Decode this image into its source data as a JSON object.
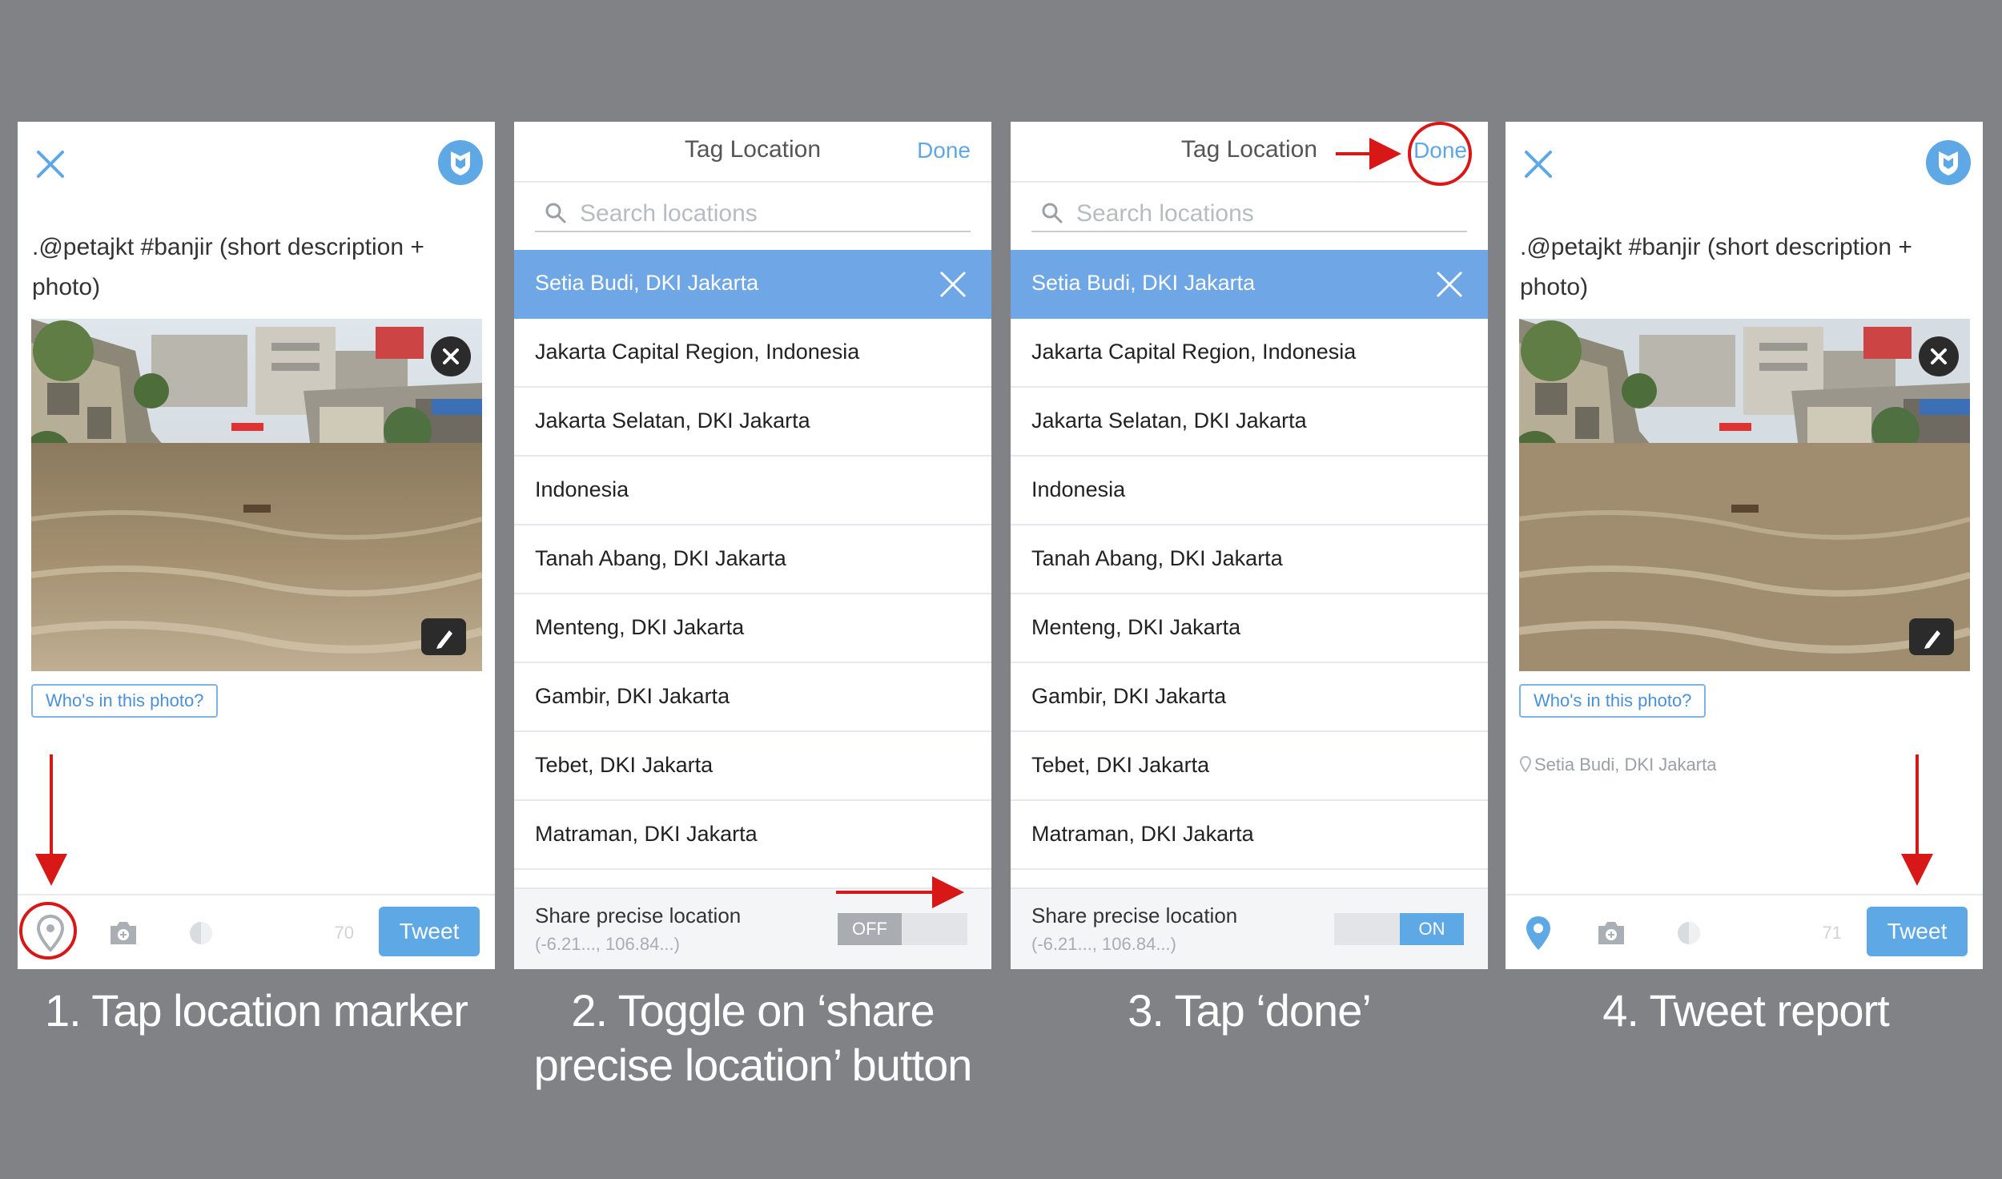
{
  "colors": {
    "background": "#808286",
    "accent": "#5ea8e6",
    "annotation": "#d81717"
  },
  "compose": {
    "tweet_text": ".@petajkt #banjir (short description + photo)",
    "who_in_photo": "Who's in this photo?",
    "tweet_button": "Tweet",
    "icons": [
      "close-icon",
      "avatar",
      "location-pin-icon",
      "camera-icon",
      "gif-icon",
      "photo-remove-icon",
      "photo-edit-icon"
    ]
  },
  "panel1": {
    "char_count": "70"
  },
  "panel4": {
    "char_count": "71",
    "location_label": "Setia Budi, DKI Jakarta"
  },
  "tag_location": {
    "title": "Tag Location",
    "done": "Done",
    "search_placeholder": "Search locations",
    "selected": "Setia Budi, DKI Jakarta",
    "locations": [
      "Jakarta Capital Region, Indonesia",
      "Jakarta Selatan, DKI Jakarta",
      "Indonesia",
      "Tanah Abang, DKI Jakarta",
      "Menteng, DKI Jakarta",
      "Gambir, DKI Jakarta",
      "Tebet, DKI Jakarta",
      "Matraman, DKI Jakarta"
    ],
    "share_label": "Share precise location",
    "coords": "(-6.21..., 106.84...)"
  },
  "toggle_off": "OFF",
  "toggle_on": "ON",
  "captions": [
    "1. Tap location marker",
    "2. Toggle on ‘share precise location’ button",
    "3. Tap ‘done’",
    "4. Tweet report"
  ]
}
